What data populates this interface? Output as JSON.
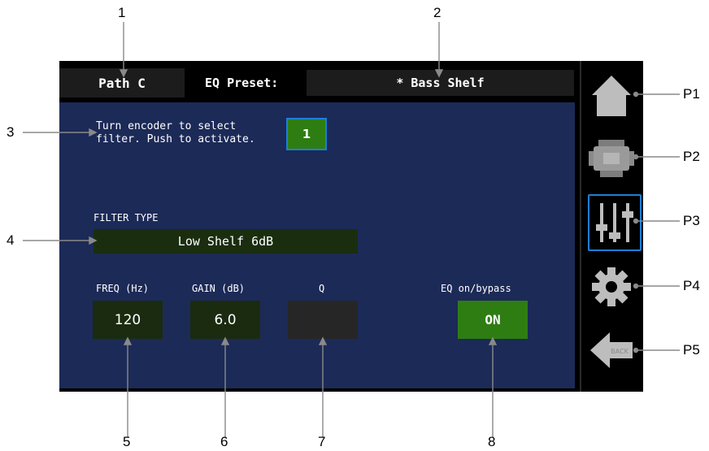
{
  "callouts": {
    "top": [
      "1",
      "2"
    ],
    "left": [
      "3",
      "4"
    ],
    "bottom": [
      "5",
      "6",
      "7",
      "8"
    ],
    "right": [
      "P1",
      "P2",
      "P3",
      "P4",
      "P5"
    ]
  },
  "header": {
    "path_label": "Path C",
    "preset_label": "EQ Preset:",
    "preset_value": "* Bass Shelf"
  },
  "main": {
    "instruction_line1": "Turn encoder to select",
    "instruction_line2": "filter. Push to activate.",
    "filter_number": "1",
    "filter_type_label": "FILTER TYPE",
    "filter_type_value": "Low Shelf 6dB",
    "freq_label": "FREQ (Hz)",
    "freq_value": "120",
    "gain_label": "GAIN (dB)",
    "gain_value": "6.0",
    "q_label": "Q",
    "q_value": "",
    "eq_label": "EQ on/bypass",
    "eq_value": "ON"
  },
  "sidebar": {
    "icons": [
      "home-icon",
      "device-icon",
      "eq-sliders-icon",
      "settings-gear-icon",
      "back-arrow-icon"
    ],
    "back_label": "BACK"
  },
  "colors": {
    "panel": "#1c2a57",
    "active_green": "#2e7d13",
    "dark_green": "#1b2b10",
    "highlight_blue": "#1e7fd6",
    "icon_gray": "#bdbdbd"
  }
}
